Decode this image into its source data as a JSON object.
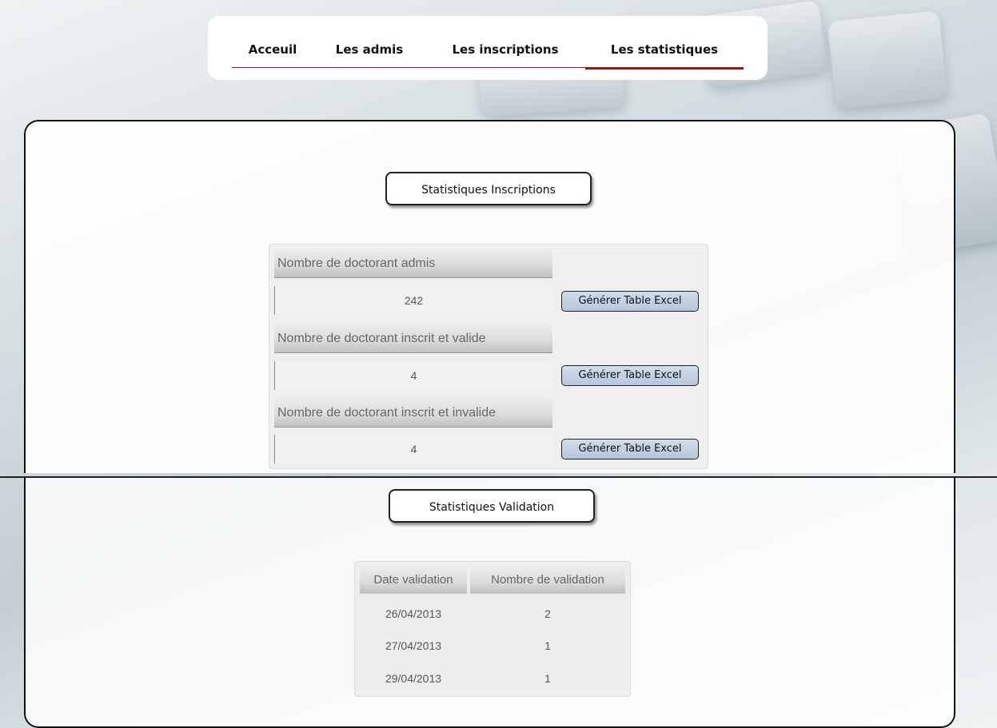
{
  "nav": {
    "items": [
      {
        "label": "Acceuil"
      },
      {
        "label": "Les admis"
      },
      {
        "label": "Les inscriptions"
      },
      {
        "label": "Les statistiques"
      }
    ]
  },
  "inscriptions": {
    "title": "Statistiques Inscriptions",
    "rows": [
      {
        "header": "Nombre de doctorant admis",
        "value": "242",
        "button": "Générer Table Excel"
      },
      {
        "header": "Nombre de doctorant inscrit et valide",
        "value": "4",
        "button": "Générer Table Excel"
      },
      {
        "header": "Nombre de doctorant inscrit et invalide",
        "value": "4",
        "button": "Générer Table Excel"
      }
    ]
  },
  "validation": {
    "title": "Statistiques Validation",
    "columns": [
      "Date validation",
      "Nombre de validation"
    ],
    "rows": [
      [
        "26/04/2013",
        "2"
      ],
      [
        "27/04/2013",
        "1"
      ],
      [
        "29/04/2013",
        "1"
      ]
    ]
  }
}
